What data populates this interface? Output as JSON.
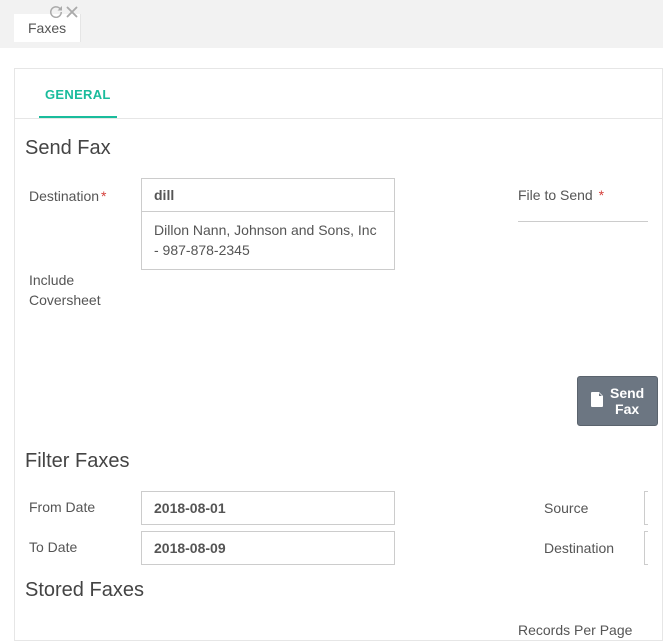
{
  "tabstrip": {
    "active_tab": "Faxes"
  },
  "tabbar": {
    "general": "GENERAL"
  },
  "sections": {
    "send_fax": "Send Fax",
    "filter_faxes": "Filter Faxes",
    "stored_faxes": "Stored Faxes"
  },
  "send": {
    "destination_label": "Destination",
    "destination_value": "dill",
    "autocomplete_option": "Dillon Nann, Johnson and Sons, Inc - 987-878-2345",
    "coversheet_label": "Include Coversheet",
    "file_label": "File to Send",
    "button": "Send Fax"
  },
  "filter": {
    "from_date_label": "From Date",
    "from_date_value": "2018-08-01",
    "to_date_label": "To Date",
    "to_date_value": "2018-08-09",
    "source_label": "Source",
    "destination_label": "Destination"
  },
  "stored": {
    "rpp_label": "Records Per Page"
  }
}
